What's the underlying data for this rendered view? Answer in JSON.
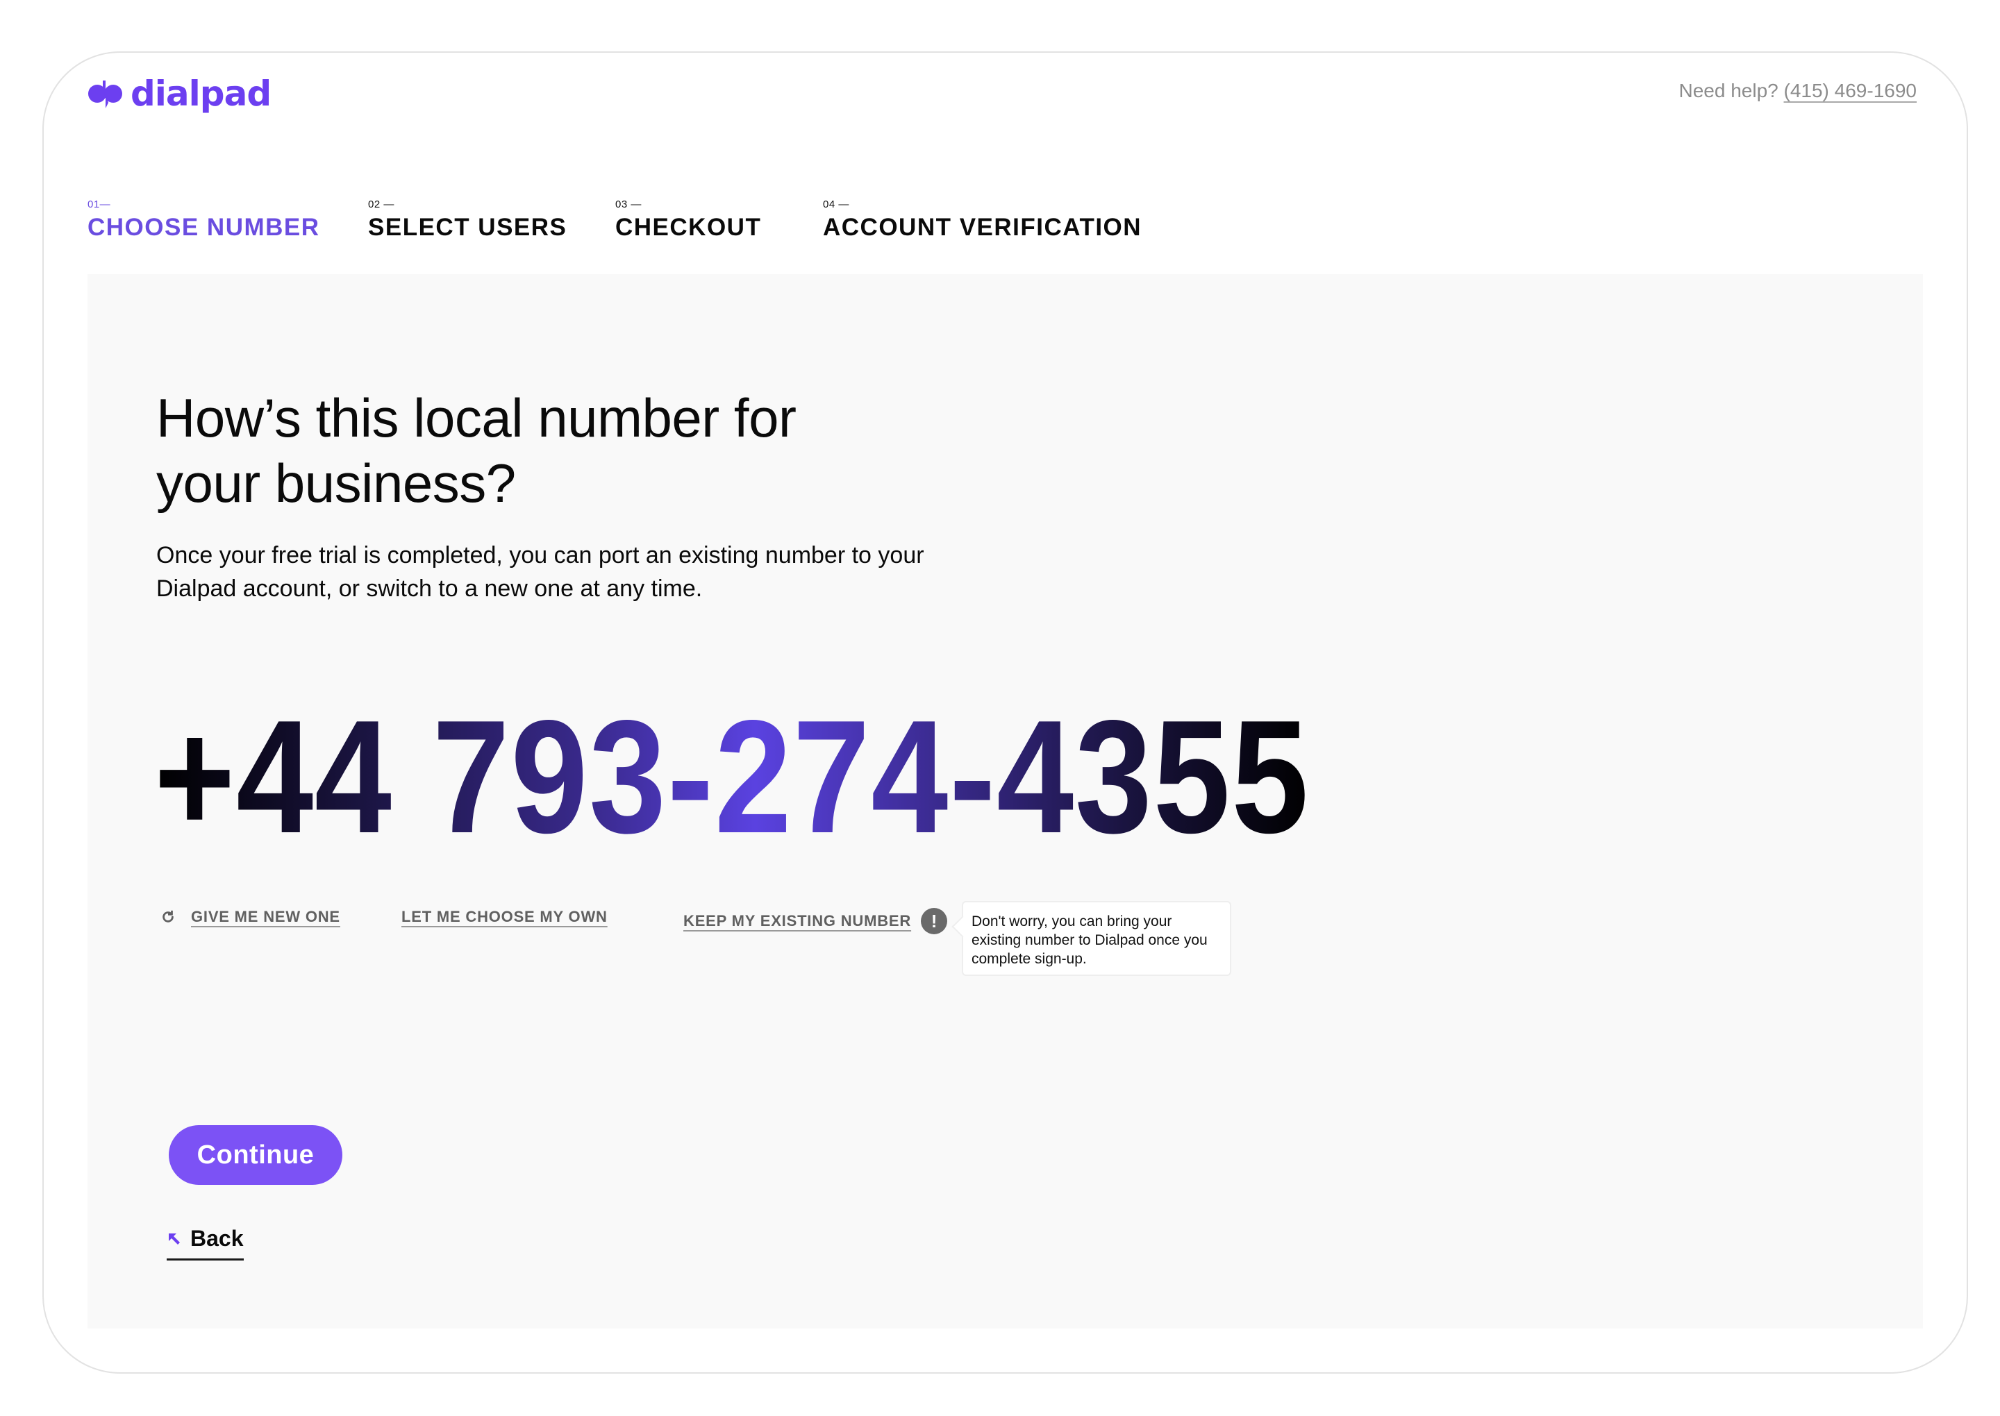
{
  "brand": {
    "name": "dialpad",
    "logo_icon": "dialpad-logo-icon",
    "accent_color": "#6c3ff0"
  },
  "help": {
    "prefix": "Need help?",
    "phone": "(415) 469-1690"
  },
  "steps": [
    {
      "number": "01—",
      "label": "CHOOSE NUMBER",
      "active": true
    },
    {
      "number": "02 —",
      "label": "SELECT USERS",
      "active": false
    },
    {
      "number": "03 —",
      "label": "CHECKOUT",
      "active": false
    },
    {
      "number": "04 —",
      "label": "ACCOUNT VERIFICATION",
      "active": false
    }
  ],
  "main": {
    "heading_line1": "How’s this local number for",
    "heading_line2": "your business?",
    "subtext": "Once your free trial is completed, you can port an existing number to your Dialpad account, or switch to a new one at any time.",
    "phone_number": "+44 793-274-4355"
  },
  "options": {
    "give_new": {
      "label": "GIVE ME NEW ONE",
      "icon": "refresh-icon"
    },
    "choose_own": {
      "label": "LET ME CHOOSE MY OWN"
    },
    "keep_existing": {
      "label": "KEEP MY EXISTING NUMBER",
      "icon": "info-icon",
      "icon_glyph": "!"
    }
  },
  "tooltip": {
    "text": "Don't worry, you can bring your existing number to Dialpad once you complete sign-up."
  },
  "actions": {
    "continue_label": "Continue",
    "continue_color": "#7c52f5",
    "back_label": "Back",
    "back_icon": "arrow-up-left-icon"
  }
}
